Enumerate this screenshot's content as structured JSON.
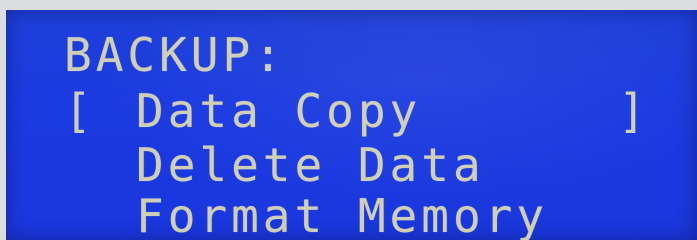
{
  "screen": {
    "title": "BACKUP:",
    "menu": {
      "selection_open": "[",
      "selection_close": "]",
      "items": [
        {
          "label": "Data Copy",
          "selected": true
        },
        {
          "label": "Delete Data",
          "selected": false
        },
        {
          "label": "Format Memory",
          "selected": false
        }
      ]
    }
  },
  "colors": {
    "background": "#1e3fd8",
    "text": "#cfcfb8"
  }
}
